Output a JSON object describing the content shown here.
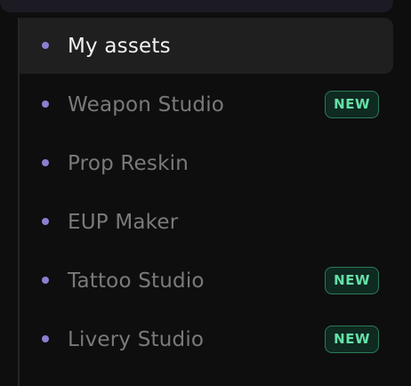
{
  "nav": {
    "items": [
      {
        "label": "My assets",
        "active": true,
        "badge": ""
      },
      {
        "label": "Weapon Studio",
        "active": false,
        "badge": "NEW"
      },
      {
        "label": "Prop Reskin",
        "active": false,
        "badge": ""
      },
      {
        "label": "EUP Maker",
        "active": false,
        "badge": ""
      },
      {
        "label": "Tattoo Studio",
        "active": false,
        "badge": "NEW"
      },
      {
        "label": "Livery Studio",
        "active": false,
        "badge": "NEW"
      }
    ]
  },
  "colors": {
    "background": "#0e0e0f",
    "active_item_bg": "#1f1f20",
    "bullet": "#8b7fd0",
    "badge_text": "#66e0a8",
    "badge_border": "#2c7a57"
  }
}
